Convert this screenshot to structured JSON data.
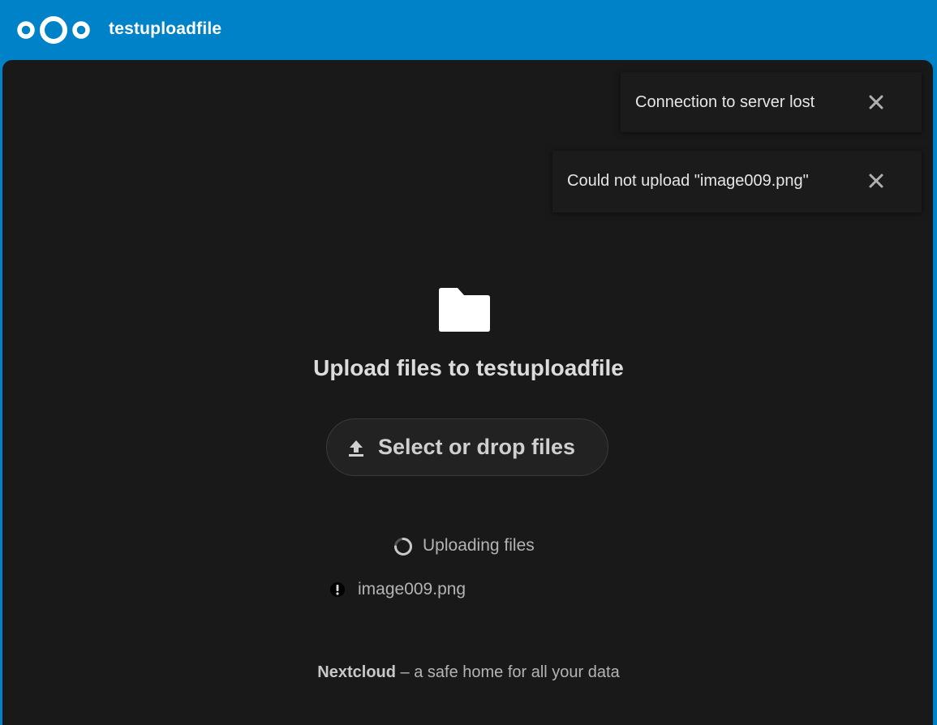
{
  "header": {
    "title": "testuploadfile",
    "logo_icon": "nextcloud-logo"
  },
  "toasts": [
    {
      "message": "Connection to server lost",
      "close_icon": "close-icon"
    },
    {
      "message": "Could not upload \"image009.png\"",
      "close_icon": "close-icon"
    }
  ],
  "main": {
    "folder_icon": "folder-icon",
    "title": "Upload files to testuploadfile",
    "select_button": "Select or drop files",
    "upload_icon": "upload-icon",
    "status": "Uploading files",
    "files": [
      {
        "name": "image009.png",
        "status_icon": "error-icon"
      }
    ]
  },
  "footer": {
    "brand": "Nextcloud",
    "tagline": " – a safe home for all your data"
  },
  "colors": {
    "header_bg": "#0082c9",
    "content_bg": "#191919",
    "toast_bg": "#1b1b1b",
    "text_primary": "#dcdcdc",
    "text_secondary": "#b4b4b4"
  }
}
